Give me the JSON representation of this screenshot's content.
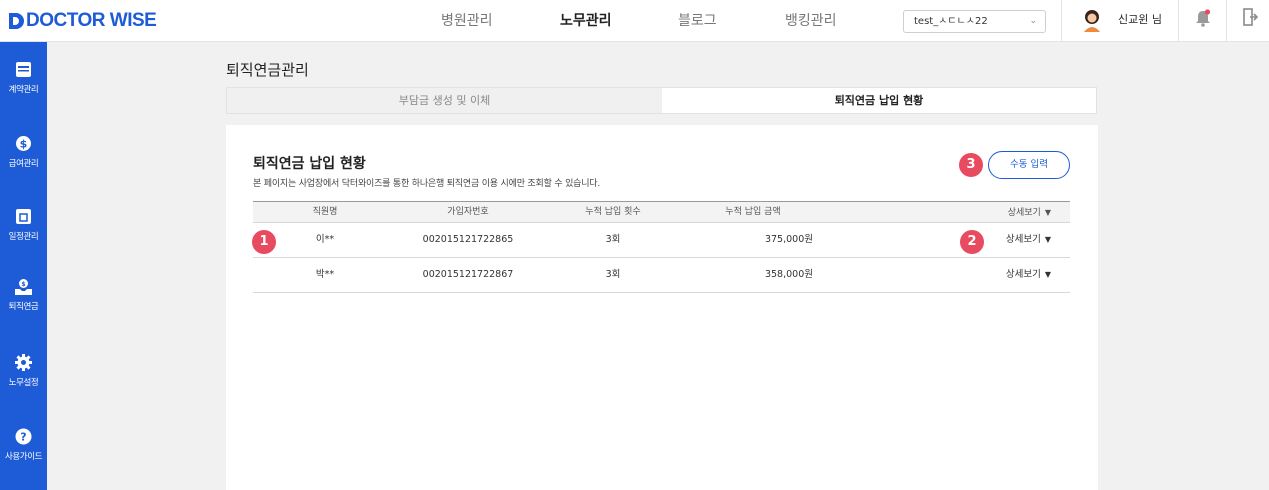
{
  "header": {
    "logo_text": "DOCTOR WISE",
    "nav": [
      "병원관리",
      "노무관리",
      "블로그",
      "뱅킹관리"
    ],
    "active_nav": "노무관리",
    "company_select": "test_ㅅㄷㄴㅅ22",
    "user_name": "신교윈 님"
  },
  "sidebar": {
    "items": [
      {
        "label": "계약관리",
        "icon": "contract-icon"
      },
      {
        "label": "급여관리",
        "icon": "dollar-icon"
      },
      {
        "label": "일정관리",
        "icon": "calendar-icon"
      },
      {
        "label": "퇴직연금",
        "icon": "pension-icon"
      },
      {
        "label": "노무설정",
        "icon": "gear-icon"
      },
      {
        "label": "사용가이드",
        "icon": "help-icon"
      }
    ]
  },
  "page": {
    "title": "퇴직연금관리",
    "tabs": [
      "부담금 생성 및 이체",
      "퇴직연금 납입 현황"
    ],
    "active_tab": "퇴직연금 납입 현황"
  },
  "section": {
    "title": "퇴직연금 납입 현황",
    "description": "본 페이지는 사업장에서 닥터와이즈를 통한 하나은행 퇴직연금 이용 시에만 조회할 수 있습니다.",
    "manual_button": "수동 입력"
  },
  "badges": [
    "1",
    "2",
    "3"
  ],
  "table": {
    "headers": [
      "직원명",
      "가입자번호",
      "누적 납입 횟수",
      "누적 납입 금액",
      "상세보기"
    ],
    "rows": [
      {
        "name": "이**",
        "number": "002015121722865",
        "count": "3회",
        "amount": "375,000원",
        "detail": "상세보기"
      },
      {
        "name": "박**",
        "number": "002015121722867",
        "count": "3회",
        "amount": "358,000원",
        "detail": "상세보기"
      }
    ]
  },
  "colors": {
    "brand": "#1e5bd6",
    "badge": "#e84a5f",
    "background": "#f1f1f1"
  }
}
